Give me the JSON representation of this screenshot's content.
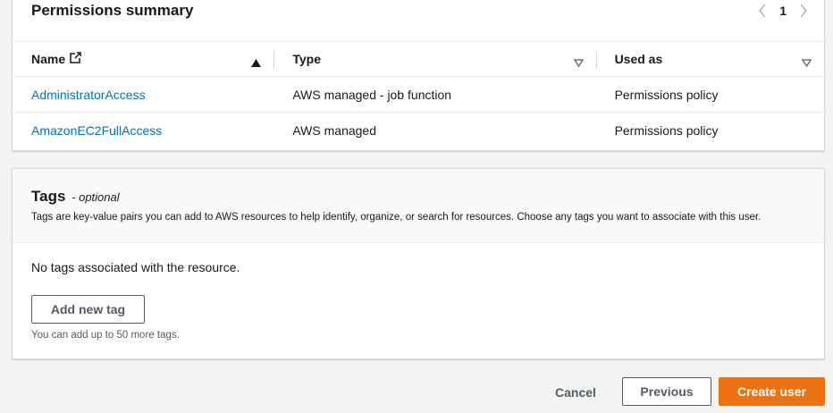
{
  "permissions": {
    "title": "Permissions summary",
    "pagination": {
      "current_page": "1",
      "prev_icon": "chevron-left-icon",
      "next_icon": "chevron-right-icon"
    },
    "columns": [
      {
        "label": "Name",
        "icon": "external-link-icon",
        "sort": "ascending"
      },
      {
        "label": "Type",
        "sort": "none"
      },
      {
        "label": "Used as",
        "sort": "none"
      }
    ],
    "rows": [
      {
        "name": "AdministratorAccess",
        "type": "AWS managed - job function",
        "used_as": "Permissions policy"
      },
      {
        "name": "AmazonEC2FullAccess",
        "type": "AWS managed",
        "used_as": "Permissions policy"
      }
    ]
  },
  "tags": {
    "title": "Tags",
    "optional": "- optional",
    "description": "Tags are key-value pairs you can add to AWS resources to help identify, organize, or search for resources. Choose any tags you want to associate with this user.",
    "empty_text": "No tags associated with the resource.",
    "add_button": "Add new tag",
    "hint": "You can add up to 50 more tags."
  },
  "footer": {
    "cancel": "Cancel",
    "previous": "Previous",
    "create": "Create user"
  },
  "colors": {
    "link": "#0073bb",
    "primary": "#ec7211",
    "background": "#f2f3f3"
  }
}
